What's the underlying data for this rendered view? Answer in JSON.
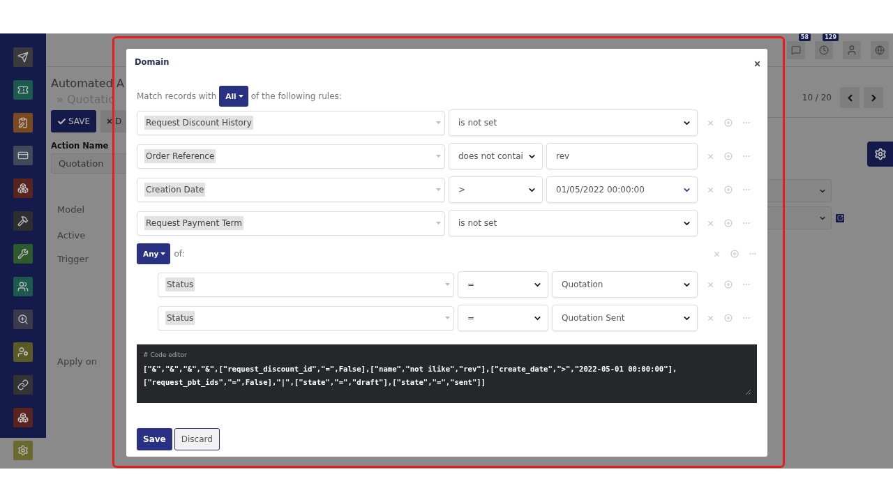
{
  "background_page": {
    "title": "Automated A",
    "breadcrumb": "» Quotatio",
    "save_button": "SAVE",
    "discard_button": "D",
    "action_name_label": "Action Name",
    "action_name_value": "Quotation",
    "labels": [
      "Model",
      "Active",
      "Trigger"
    ],
    "apply_label": "Apply on",
    "pager": "10 / 20",
    "badges": [
      "58",
      "129"
    ]
  },
  "modal": {
    "title": "Domain",
    "match": {
      "prefix": "Match records with",
      "quantifier": "All",
      "suffix": "of the following rules:"
    },
    "rules": [
      {
        "kind": "rule",
        "field": "Request Discount History",
        "operator": "is not set"
      },
      {
        "kind": "rule",
        "field": "Order Reference",
        "operator": "does not contai",
        "value": {
          "kind": "text",
          "text": "rev"
        }
      },
      {
        "kind": "rule",
        "field": "Creation Date",
        "operator": ">",
        "value": {
          "kind": "date",
          "text": "01/05/2022 00:00:00"
        }
      },
      {
        "kind": "rule",
        "field": "Request Payment Term",
        "operator": "is not set"
      },
      {
        "kind": "group",
        "quantifier": "Any",
        "suffix": "of:",
        "children": [
          {
            "kind": "rule",
            "field": "Status",
            "operator": "=",
            "value": {
              "kind": "select",
              "text": "Quotation"
            }
          },
          {
            "kind": "rule",
            "field": "Status",
            "operator": "=",
            "value": {
              "kind": "select",
              "text": "Quotation Sent"
            }
          }
        ]
      }
    ],
    "code_editor": {
      "label": "# Code editor",
      "lines": [
        "[\"&\",\"&\",\"&\",\"&\",[\"request_discount_id\",\"=\",False],[\"name\",\"not ilike\",\"rev\"],[\"create_date\",\">\",\"2022-05-01 00:00:00\"],",
        "[\"request_pbt_ids\",\"=\",False],\"|\",[\"state\",\"=\",\"draft\"],[\"state\",\"=\",\"sent\"]]"
      ]
    },
    "buttons": [
      {
        "label": "Save",
        "kind": "primary"
      },
      {
        "label": "Discard",
        "kind": "secondary"
      }
    ]
  }
}
